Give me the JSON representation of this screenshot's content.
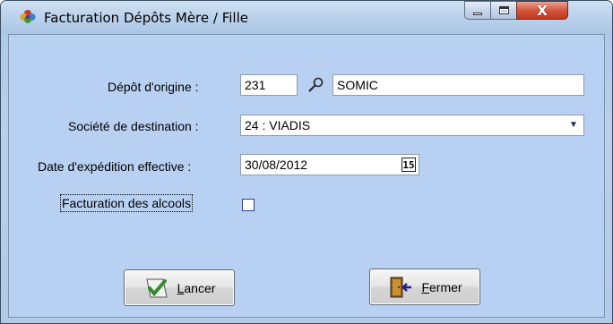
{
  "window": {
    "title": "Facturation Dépôts Mère / Fille",
    "icon": "flower-app-icon",
    "controls": {
      "minimize": "minimize",
      "maximize": "maximize",
      "close": "X"
    }
  },
  "form": {
    "depot_origine": {
      "label": "Dépôt d'origine :",
      "code": "231",
      "name": "SOMIC",
      "lookup_icon": "lookup-icon"
    },
    "societe_destination": {
      "label": "Société de destination :",
      "value": "24 : VIADIS"
    },
    "date_expedition": {
      "label": "Date d'expédition effective :",
      "value": "30/08/2012",
      "calendar_glyph": "15"
    },
    "facturation_alcools": {
      "label": "Facturation des alcools",
      "checked": false
    }
  },
  "buttons": {
    "lancer": {
      "label_first": "L",
      "label_rest": "ancer",
      "icon": "checkmark-icon"
    },
    "fermer": {
      "label_first": "F",
      "label_rest": "ermer",
      "icon": "exit-door-icon"
    }
  },
  "colors": {
    "client_background": "#b8d1f3",
    "close_button": "#c2351b",
    "checkbox_border": "#2a3f9c"
  }
}
